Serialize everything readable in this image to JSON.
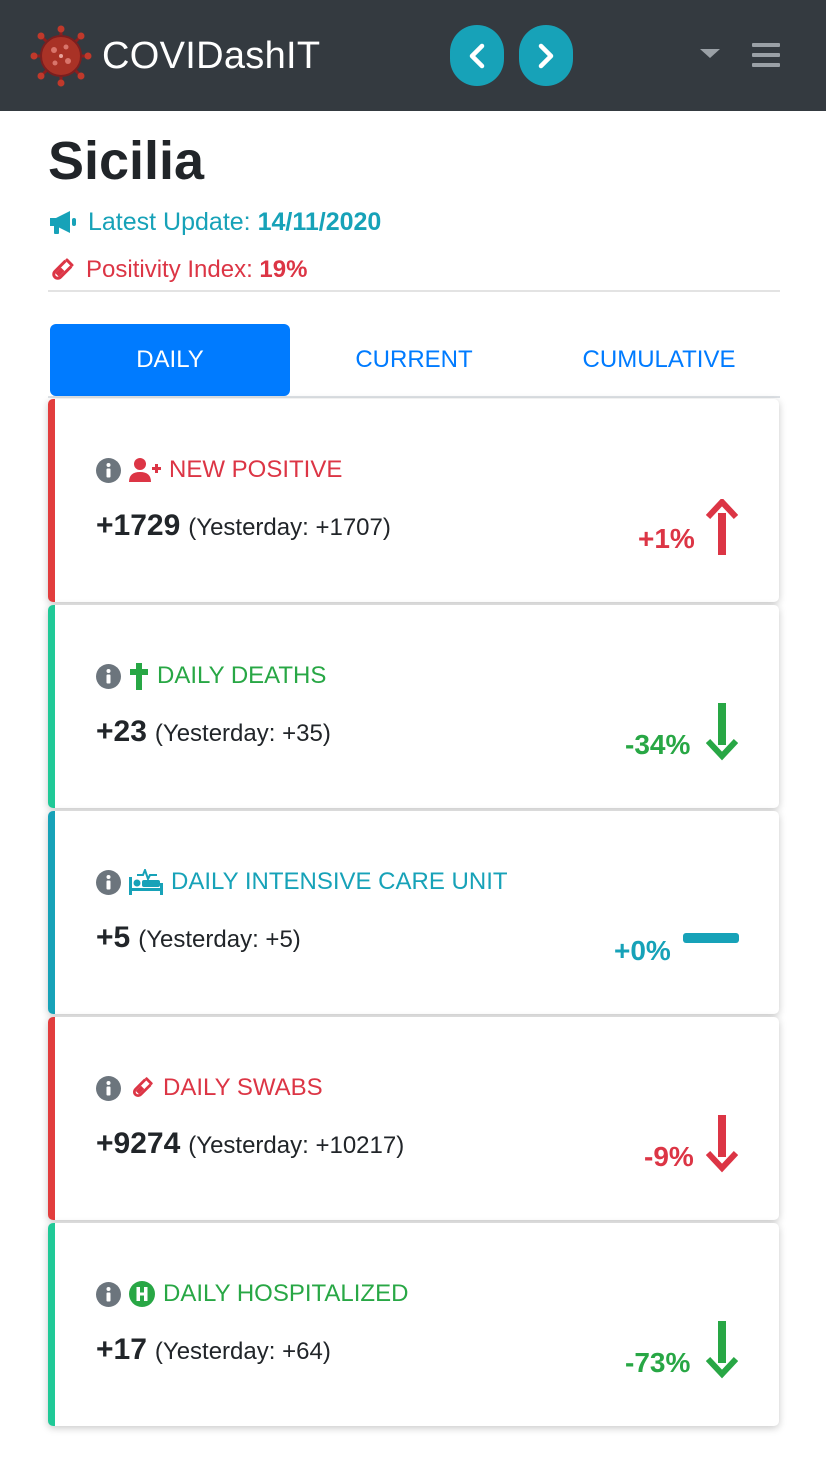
{
  "navbar": {
    "brand": "COVIDashIT",
    "prev_icon": "chevron-left-icon",
    "next_icon": "chevron-right-icon",
    "dropdown_icon": "caret-down-icon",
    "menu_icon": "hamburger-menu-icon"
  },
  "header": {
    "region": "Sicilia",
    "latest_update_label": "Latest Update:",
    "latest_update_value": "14/11/2020",
    "positivity_label": "Positivity Index:",
    "positivity_value": "19%"
  },
  "tabs": [
    {
      "label": "DAILY",
      "active": true
    },
    {
      "label": "CURRENT",
      "active": false
    },
    {
      "label": "CUMULATIVE",
      "active": false
    }
  ],
  "cards": [
    {
      "title": "NEW POSITIVE",
      "icon": "user-plus-icon",
      "value": "+1729",
      "yesterday_label": "Yesterday:",
      "yesterday_value": "+1707",
      "change": "+1%",
      "trend": "up",
      "color": "#dc3545"
    },
    {
      "title": "DAILY DEATHS",
      "icon": "cross-icon",
      "value": "+23",
      "yesterday_label": "Yesterday:",
      "yesterday_value": "+35",
      "change": "-34%",
      "trend": "down",
      "color": "#28a745"
    },
    {
      "title": "DAILY INTENSIVE CARE UNIT",
      "icon": "procedures-bed-icon",
      "value": "+5",
      "yesterday_label": "Yesterday:",
      "yesterday_value": "+5",
      "change": "+0%",
      "trend": "flat",
      "color": "#17a2b8"
    },
    {
      "title": "DAILY SWABS",
      "icon": "vial-icon",
      "value": "+9274",
      "yesterday_label": "Yesterday:",
      "yesterday_value": "+10217",
      "change": "-9%",
      "trend": "down",
      "color": "#dc3545"
    },
    {
      "title": "DAILY HOSPITALIZED",
      "icon": "hospital-h-icon",
      "value": "+17",
      "yesterday_label": "Yesterday:",
      "yesterday_value": "+64",
      "change": "-73%",
      "trend": "down",
      "color": "#28a745"
    }
  ],
  "colors": {
    "navbar_bg": "#343a40",
    "accent_teal": "#17a2b8",
    "primary_blue": "#007bff",
    "danger_red": "#dc3545",
    "success_green": "#28a745"
  }
}
